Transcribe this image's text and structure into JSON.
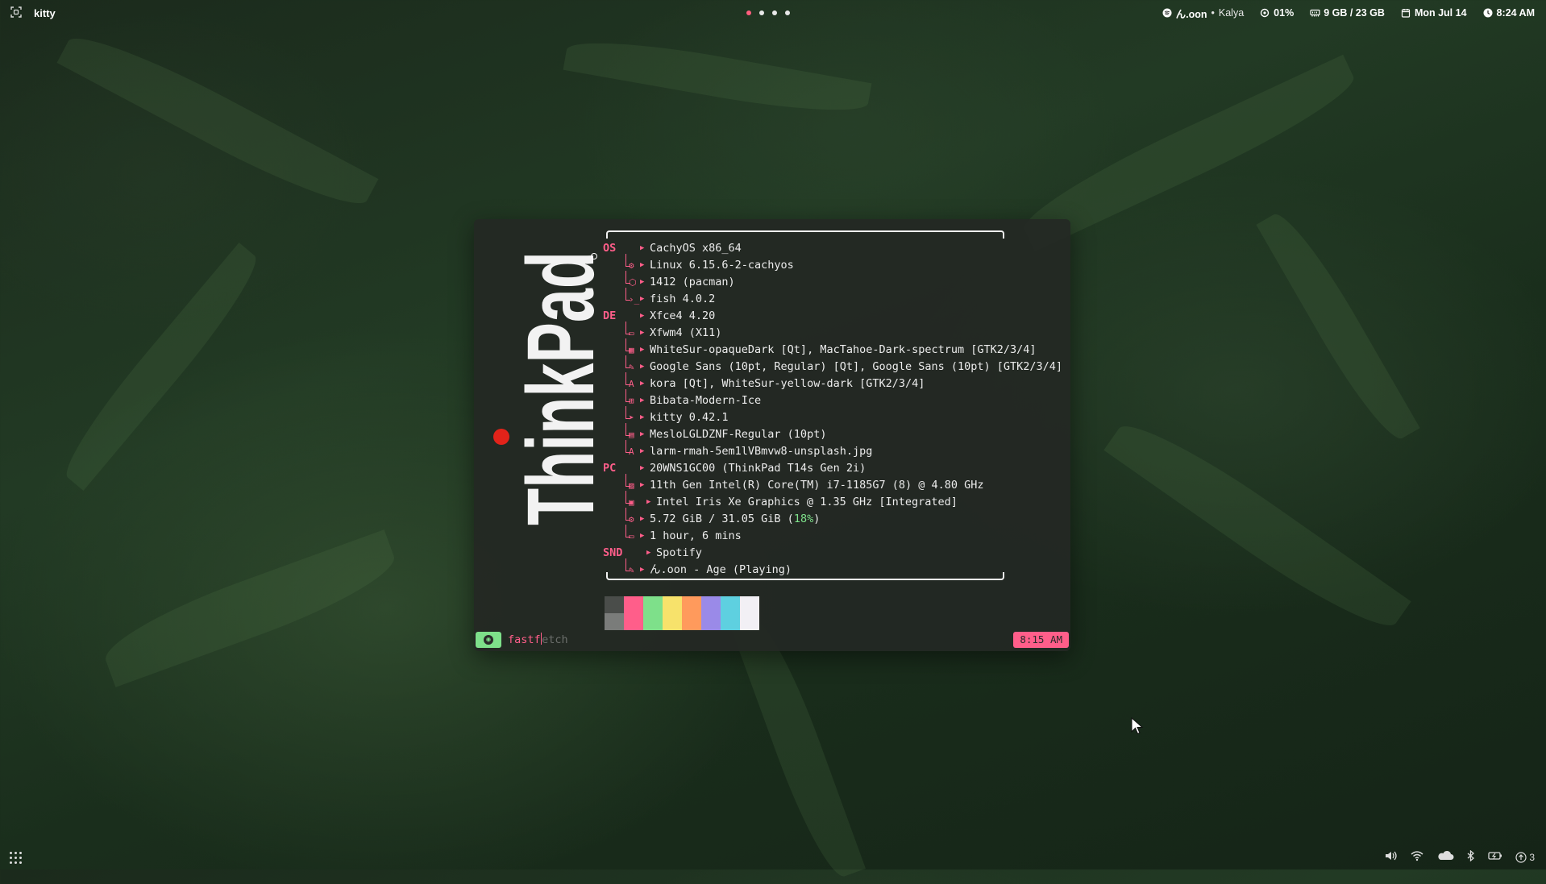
{
  "topbar": {
    "app_name": "kitty",
    "workspaces": 4,
    "active_workspace": 1,
    "media_artist": "ん.oon",
    "media_title": "Kalya",
    "cpu": "01%",
    "memory": "9 GB / 23 GB",
    "date": "Mon Jul 14",
    "time": "8:24 AM"
  },
  "terminal": {
    "logo_text": "ThinkPad",
    "rows": [
      {
        "key": "OS",
        "val": "CachyOS x86_64"
      },
      {
        "val": "Linux 6.15.6-2-cachyos"
      },
      {
        "val": "1412 (pacman)"
      },
      {
        "val": "fish 4.0.2"
      },
      {
        "key": "DE",
        "val": "Xfce4 4.20"
      },
      {
        "val": "Xfwm4 (X11)"
      },
      {
        "val": "WhiteSur-opaqueDark [Qt], MacTahoe-Dark-spectrum [GTK2/3/4]"
      },
      {
        "val": "Google Sans (10pt, Regular) [Qt], Google Sans (10pt) [GTK2/3/4]"
      },
      {
        "val": "kora [Qt], WhiteSur-yellow-dark [GTK2/3/4]"
      },
      {
        "val": "Bibata-Modern-Ice"
      },
      {
        "val": "kitty 0.42.1"
      },
      {
        "val": "MesloLGLDZNF-Regular (10pt)"
      },
      {
        "val": "larm-rmah-5em1lVBmvw8-unsplash.jpg"
      },
      {
        "key": "PC",
        "val": "20WNS1GC00 (ThinkPad T14s Gen 2i)"
      },
      {
        "val": "11th Gen Intel(R) Core(TM) i7-1185G7 (8) @ 4.80 GHz"
      },
      {
        "val": "Intel Iris Xe Graphics @ 1.35 GHz [Integrated]"
      },
      {
        "val": "5.72 GiB / 31.05 GiB (",
        "pct": "18%",
        "tail": ")"
      },
      {
        "val": "1 hour, 6 mins"
      },
      {
        "key": "SND",
        "val": "Spotify"
      },
      {
        "val": "ん.oon - Age (Playing)"
      }
    ],
    "swatch_colors": [
      "split",
      "#ff5e8a",
      "#7ee08a",
      "#f7e26b",
      "#ff9a5c",
      "#9a8ae8",
      "#5ed0e0",
      "#f2f0f5"
    ],
    "command_typed": "fastf",
    "command_suggest": "etch",
    "prompt_time": "8:15 AM"
  },
  "bottombar": {
    "notification_count": "3"
  }
}
